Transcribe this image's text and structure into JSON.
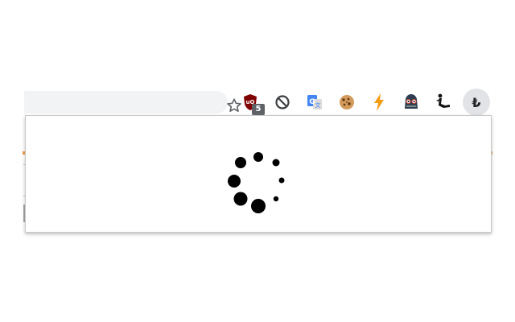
{
  "toolbar": {
    "bookmark_icon": "star-icon",
    "extensions": [
      {
        "name": "ublock-origin",
        "icon": "ublock-shield-icon",
        "badge": "5",
        "color": "#800000"
      },
      {
        "name": "blocker",
        "icon": "block-circle-icon",
        "color": "#5f6368"
      },
      {
        "name": "google-translate",
        "icon": "translate-icon",
        "color": "#4285f4"
      },
      {
        "name": "cookie-manager",
        "icon": "cookie-icon",
        "color": "#c68642"
      },
      {
        "name": "lightning",
        "icon": "lightning-bolt-icon",
        "color": "#f39c12"
      },
      {
        "name": "spy-mask",
        "icon": "spy-mask-icon",
        "color": "#2c3e50"
      },
      {
        "name": "figure",
        "icon": "figure-icon",
        "color": "#111111"
      },
      {
        "name": "currency-converter",
        "icon": "lira-sign-icon",
        "glyph": "₺",
        "active": true
      }
    ]
  },
  "popup": {
    "state": "loading",
    "spinner_icon": "loading-spinner-icon",
    "spinner_color": "#000000"
  }
}
